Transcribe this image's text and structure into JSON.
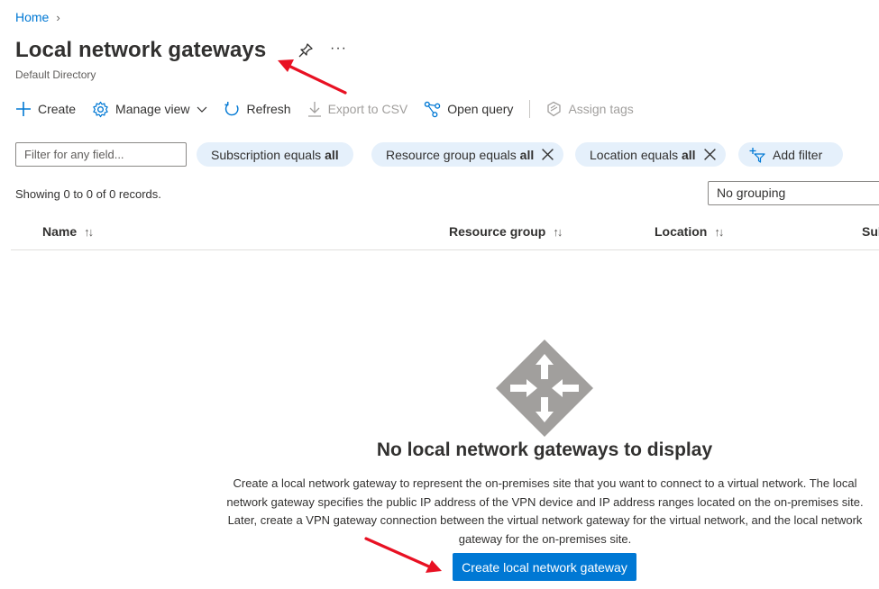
{
  "breadcrumb": {
    "home": "Home",
    "separator": "›"
  },
  "header": {
    "title": "Local network gateways",
    "subtitle": "Default Directory",
    "more": "···"
  },
  "toolbar": {
    "create": "Create",
    "manage_view": "Manage view",
    "refresh": "Refresh",
    "export_csv": "Export to CSV",
    "open_query": "Open query",
    "assign_tags": "Assign tags"
  },
  "filters": {
    "placeholder": "Filter for any field...",
    "subscription": {
      "prefix": "Subscription equals",
      "value": "all"
    },
    "resource_group": {
      "prefix": "Resource group equals",
      "value": "all"
    },
    "location": {
      "prefix": "Location equals",
      "value": "all"
    },
    "add_filter": "Add filter"
  },
  "records": {
    "showing": "Showing 0 to 0 of 0 records."
  },
  "grouping": {
    "selected": "No grouping"
  },
  "table": {
    "columns": [
      "Name",
      "Resource group",
      "Location",
      "Sul"
    ],
    "sort_glyph": "↑↓"
  },
  "empty_state": {
    "title": "No local network gateways to display",
    "description": "Create a local network gateway to represent the on-premises site that you want to connect to a virtual network. The local network gateway specifies the public IP address of the VPN device and IP address ranges located on the on-premises site. Later, create a VPN gateway connection between the virtual network gateway for the virtual network, and the local network gateway for the on-premises site.",
    "button": "Create local network gateway"
  },
  "colors": {
    "accent": "#0078d4",
    "pill_bg": "#e5f0fb",
    "annotation_arrow": "#e81123",
    "empty_icon": "#a19f9d"
  }
}
